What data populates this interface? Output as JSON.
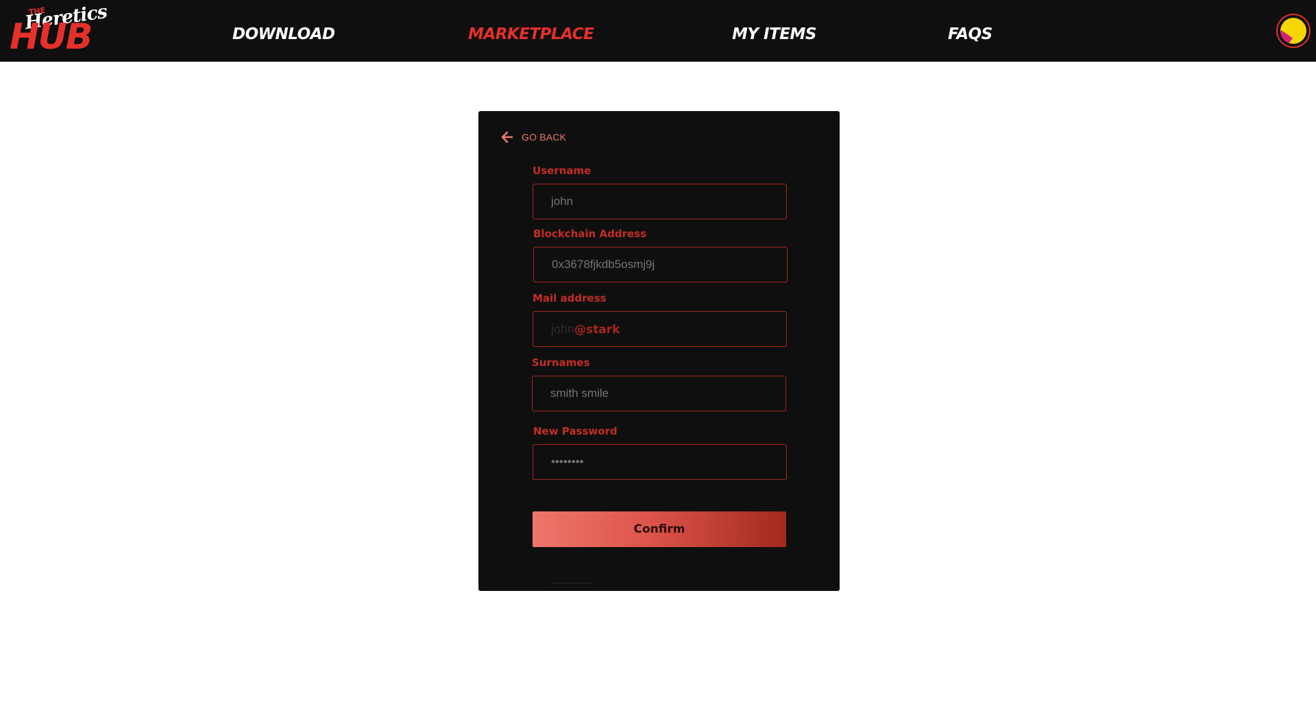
{
  "brand": {
    "the": "THE",
    "heretics": "Heretics",
    "hub": "HUB"
  },
  "nav": {
    "items": [
      {
        "label": "DOWNLOAD"
      },
      {
        "label": "MARKETPLACE",
        "active": true
      },
      {
        "label": "MY ITEMS"
      },
      {
        "label": "FAQS"
      }
    ]
  },
  "form": {
    "go_back": "GO BACK",
    "username": {
      "label": "Username",
      "placeholder": "john"
    },
    "blockchain": {
      "label": "Blockchain Address",
      "placeholder": "0x3678fjkdb5osmj9j"
    },
    "mail": {
      "label": "Mail address",
      "value_prefix": "john",
      "value_typed": "@stark"
    },
    "surnames": {
      "label": "Surnames",
      "placeholder": "smith smile"
    },
    "password": {
      "label": "New Password",
      "placeholder": "••••••••"
    },
    "confirm_label": "Confirm"
  },
  "colors": {
    "header_bg": "#0f0f0f",
    "accent": "#e5302a",
    "label_red": "#c22e25",
    "card_bg": "#0f0f0f"
  },
  "icons": {
    "back": "arrow-left-icon",
    "avatar": "user-avatar-icon"
  }
}
